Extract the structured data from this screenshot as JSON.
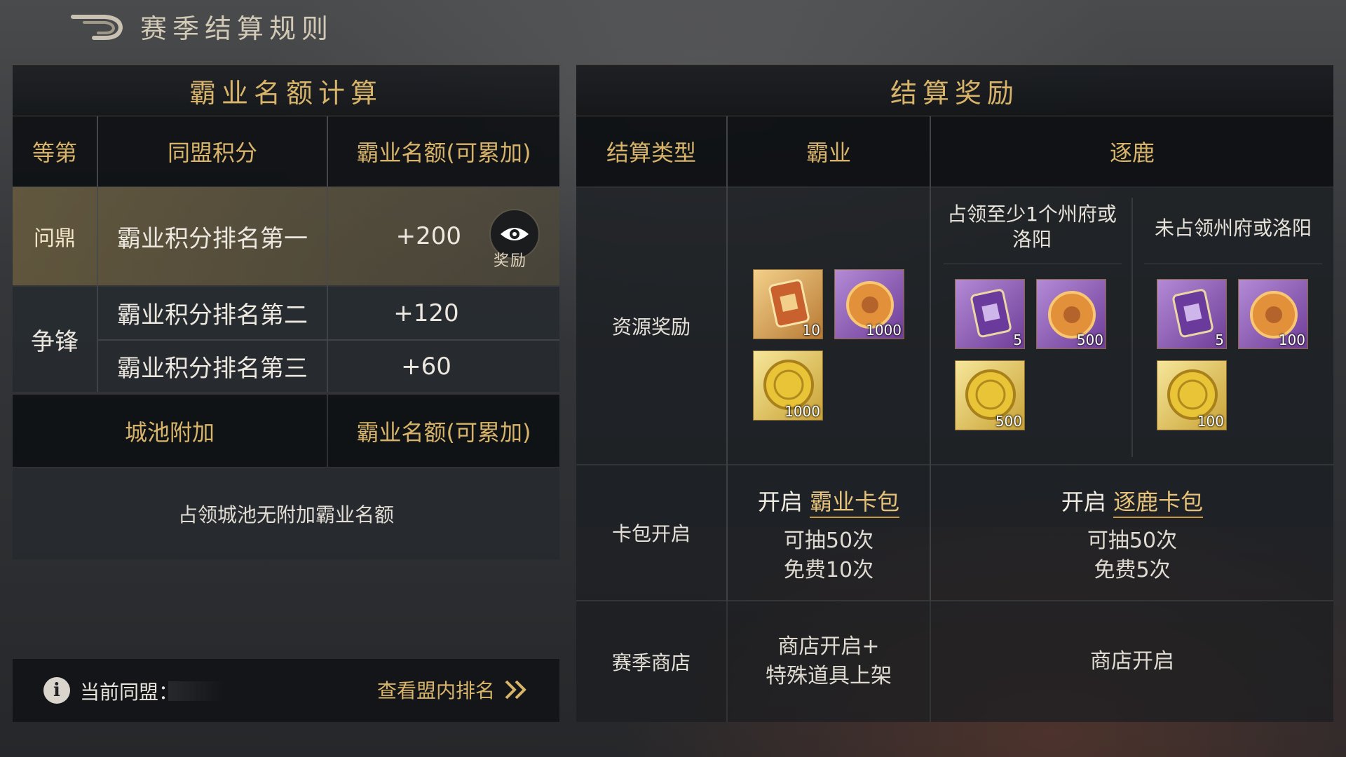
{
  "header": {
    "title": "赛季结算规则",
    "back_icon": "back-arrow-icon"
  },
  "left_panel": {
    "title": "霸业名额计算",
    "columns": [
      "等第",
      "同盟积分",
      "霸业名额(可累加)"
    ],
    "rows": [
      {
        "tier": "问鼎",
        "condition": "霸业积分排名第一",
        "value": "+200"
      },
      {
        "tier": "争锋",
        "condition": "霸业积分排名第二",
        "value": "+120"
      },
      {
        "tier": "争锋",
        "condition": "霸业积分排名第三",
        "value": "+60"
      }
    ],
    "reward_button": {
      "label": "奖励",
      "icon": "eye-icon"
    },
    "city_header": [
      "城池附加",
      "霸业名额(可累加)"
    ],
    "city_note": "占领城池无附加霸业名额"
  },
  "info_bar": {
    "label": "当前同盟：",
    "link": "查看盟内排名",
    "icon": "info-icon",
    "link_icon": "double-chevron-right-icon"
  },
  "right_panel": {
    "title": "结算奖励",
    "columns": [
      "结算类型",
      "霸业",
      "逐鹿"
    ],
    "zhulu_sub": [
      "占领至少1个州府或洛阳",
      "未占领州府或洛阳"
    ],
    "resource_label": "资源奖励",
    "badu_items": [
      {
        "type": "order-token-icon",
        "qty": "10"
      },
      {
        "type": "jade-icon",
        "qty": "1000"
      },
      {
        "type": "gold-coin-icon",
        "qty": "1000"
      }
    ],
    "zhulu_a_items": [
      {
        "type": "order-token-icon",
        "qty": "5"
      },
      {
        "type": "jade-icon",
        "qty": "500"
      },
      {
        "type": "gold-coin-icon",
        "qty": "500"
      }
    ],
    "zhulu_b_items": [
      {
        "type": "order-token-icon",
        "qty": "5"
      },
      {
        "type": "jade-icon",
        "qty": "100"
      },
      {
        "type": "gold-coin-icon",
        "qty": "100"
      }
    ],
    "card_label": "卡包开启",
    "badu_card": {
      "prefix": "开启",
      "name": "霸业卡包",
      "line1": "可抽50次",
      "line2": "免费10次"
    },
    "zhulu_card": {
      "prefix": "开启",
      "name": "逐鹿卡包",
      "line1": "可抽50次",
      "line2": "免费5次"
    },
    "shop_label": "赛季商店",
    "badu_shop": [
      "商店开启+",
      "特殊道具上架"
    ],
    "zhulu_shop": "商店开启"
  },
  "colors": {
    "gold": "#d7b46a",
    "highlight_row": "#6e603e"
  }
}
